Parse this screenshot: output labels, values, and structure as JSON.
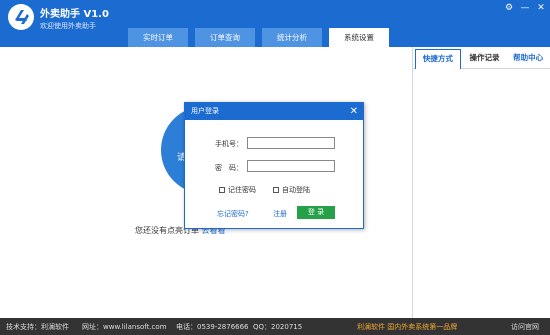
{
  "app": {
    "title": "外卖助手 V1.0",
    "subtitle": "欢迎使用外卖助手"
  },
  "window_controls": {
    "settings": "⚙",
    "minimize": "—",
    "close": "✕"
  },
  "tabs": [
    {
      "label": "实时订单",
      "active": false
    },
    {
      "label": "订单查询",
      "active": false
    },
    {
      "label": "统计分析",
      "active": false
    },
    {
      "label": "系统设置",
      "active": true
    }
  ],
  "main": {
    "circle_text": "请",
    "empty_text": "您还没有点亮订单",
    "empty_link": "去看看"
  },
  "right_panel": {
    "tabs": [
      {
        "label": "快捷方式",
        "active": true
      },
      {
        "label": "操作记录",
        "active": false
      },
      {
        "label": "帮助中心",
        "active": false
      }
    ]
  },
  "dialog": {
    "title": "用户登录",
    "close_icon": "✕",
    "phone_label": "手机号：",
    "phone_value": "",
    "password_label": "密　码：",
    "password_value": "",
    "remember_label": "记住密码",
    "autologin_label": "自动登陆",
    "forgot_label": "忘记密码?",
    "register_label": "注册",
    "login_label": "登 录"
  },
  "footer": {
    "support_label": "技术支持：利澜软件",
    "website_label": "网址：www.lilansoft.com",
    "phone_label": "电话：0539-2876666",
    "qq_label": "QQ：2020715",
    "brand_label": "利澜软件  国内外卖系统第一品牌",
    "visit_label": "访问官网"
  },
  "colors": {
    "header_blue": "#1b6bd0",
    "tab_blue": "#4f93e3",
    "login_green": "#27a04a",
    "footer_bg": "#333333",
    "brand_orange": "#f0a830"
  }
}
